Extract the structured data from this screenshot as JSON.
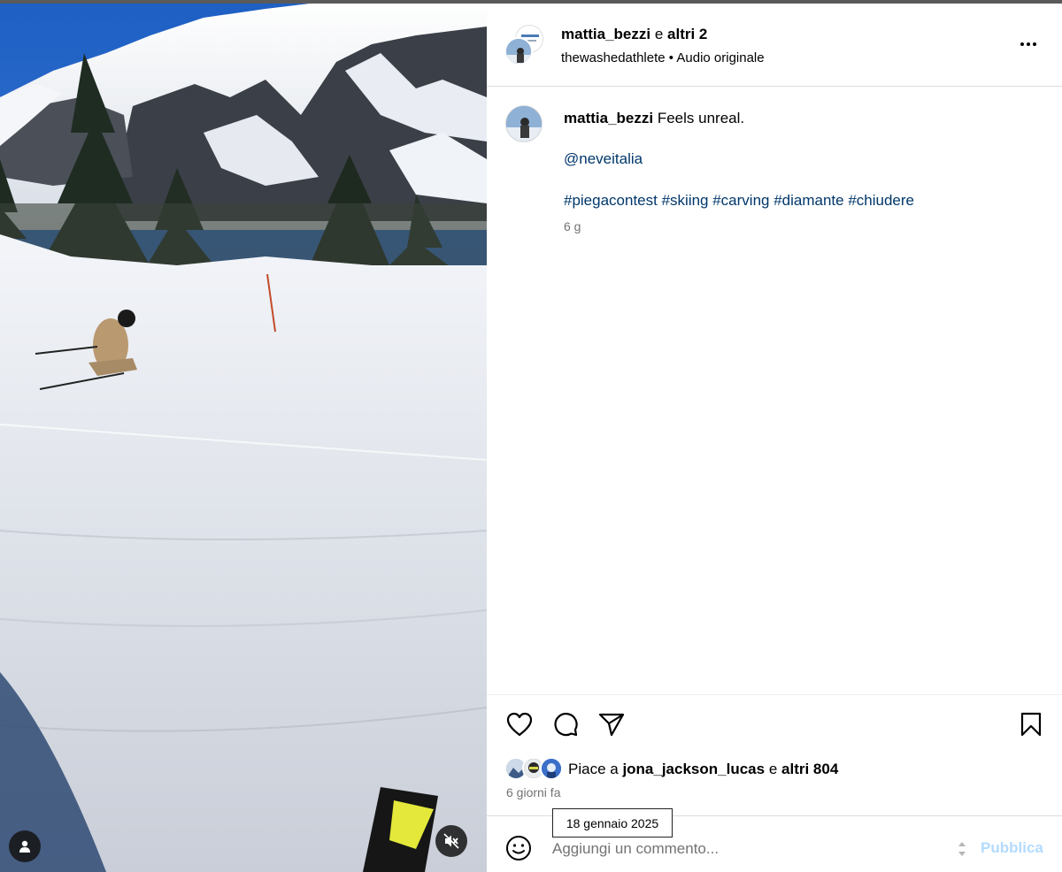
{
  "post": {
    "author": "mattia_bezzi",
    "coauthors_connector": "e",
    "coauthors_label": "altri 2",
    "audio_account": "thewashedathlete",
    "audio_separator": "•",
    "audio_label": "Audio originale"
  },
  "caption": {
    "author": "mattia_bezzi",
    "text": "Feels unreal.",
    "mention": "@neveitalia",
    "hashtags": "#piegacontest #skiing #carving #diamante #chiudere",
    "age": "6 g"
  },
  "likes": {
    "prefix": "Piace a",
    "first_liker": "jona_jackson_lucas",
    "connector": "e",
    "others": "altri 804"
  },
  "timestamp": {
    "relative": "6 giorni fa",
    "tooltip": "18 gennaio 2025"
  },
  "comment_box": {
    "placeholder": "Aggiungi un commento...",
    "publish_label": "Pubblica"
  },
  "icons": {
    "more": "more-horizontal-icon",
    "like": "heart-icon",
    "comment": "comment-bubble-icon",
    "share": "paper-plane-icon",
    "save": "bookmark-icon",
    "emoji": "smiley-icon",
    "user_tag": "person-icon",
    "mute": "speaker-muted-icon"
  },
  "colors": {
    "link": "#00376b",
    "secondary_text": "#737373",
    "publish_disabled": "#b3dbff",
    "divider": "#dbdbdb"
  }
}
